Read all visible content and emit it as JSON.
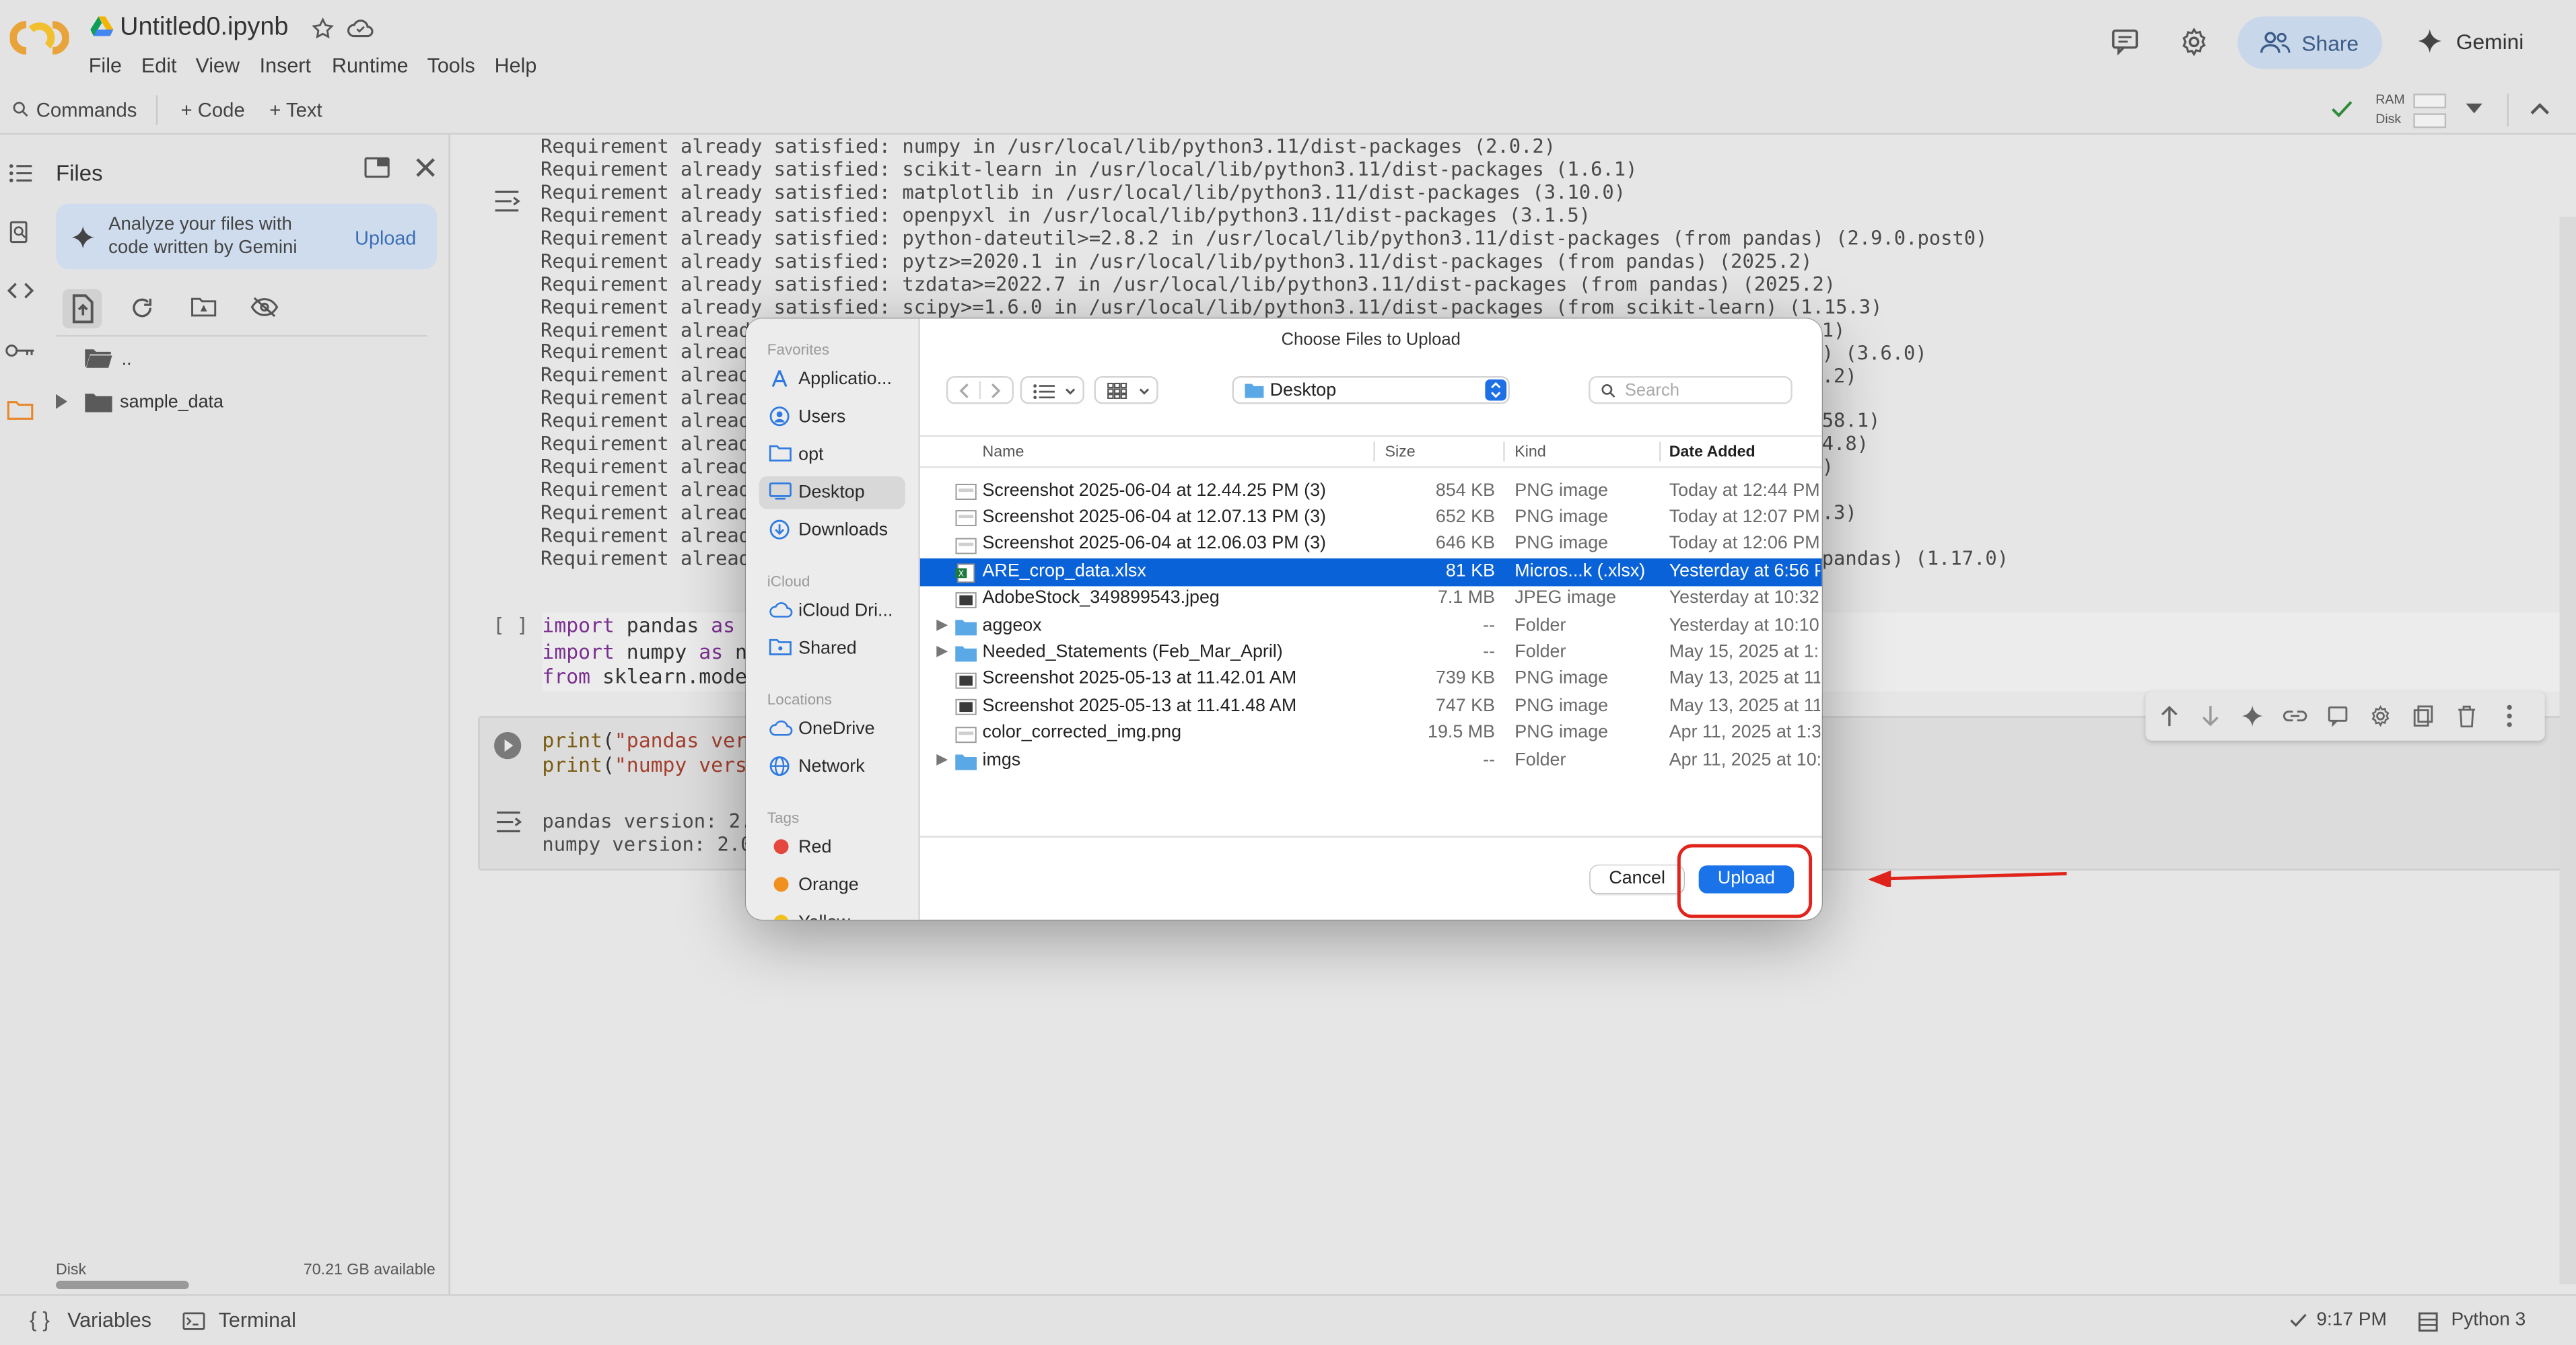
{
  "header": {
    "notebook_title": "Untitled0.ipynb",
    "menu": [
      "File",
      "Edit",
      "View",
      "Insert",
      "Runtime",
      "Tools",
      "Help"
    ],
    "share_label": "Share",
    "gemini_label": "Gemini"
  },
  "toolbar": {
    "commands_label": "Commands",
    "add_code_label": "+ Code",
    "add_text_label": "+ Text",
    "ram_label": "RAM",
    "disk_label": "Disk"
  },
  "sidebar": {
    "title": "Files",
    "gemini_prompt": "Analyze your files with code written by Gemini",
    "gemini_upload": "Upload",
    "tree": [
      {
        "label": ".."
      },
      {
        "label": "sample_data"
      }
    ],
    "disk_label": "Disk",
    "disk_available": "70.21 GB available"
  },
  "output_lines": [
    "Requirement already satisfied: numpy in /usr/local/lib/python3.11/dist-packages (2.0.2)",
    "Requirement already satisfied: scikit-learn in /usr/local/lib/python3.11/dist-packages (1.6.1)",
    "Requirement already satisfied: matplotlib in /usr/local/lib/python3.11/dist-packages (3.10.0)",
    "Requirement already satisfied: openpyxl in /usr/local/lib/python3.11/dist-packages (3.1.5)",
    "Requirement already satisfied: python-dateutil>=2.8.2 in /usr/local/lib/python3.11/dist-packages (from pandas) (2.9.0.post0)",
    "Requirement already satisfied: pytz>=2020.1 in /usr/local/lib/python3.11/dist-packages (from pandas) (2025.2)",
    "Requirement already satisfied: tzdata>=2022.7 in /usr/local/lib/python3.11/dist-packages (from pandas) (2025.2)",
    "Requirement already satisfied: scipy>=1.6.0 in /usr/local/lib/python3.11/dist-packages (from scikit-learn) (1.15.3)",
    "Requirement alread",
    "Requirement alread",
    "Requirement alread",
    "Requirement alread",
    "Requirement alread",
    "Requirement alread",
    "Requirement alread",
    "Requirement alread",
    "Requirement alread",
    "Requirement alread",
    "Requirement alread"
  ],
  "output_tails": [
    {
      "line": 8,
      "text": "1)"
    },
    {
      "line": 9,
      "text": ") (3.6.0)"
    },
    {
      "line": 10,
      "text": ".2)"
    },
    {
      "line": 12,
      "text": "58.1)"
    },
    {
      "line": 13,
      "text": "4.8)"
    },
    {
      "line": 14,
      "text": ")"
    },
    {
      "line": 16,
      "text": ".3)"
    },
    {
      "line": 18,
      "text": "pandas) (1.17.0)"
    }
  ],
  "cell2": {
    "prompt": "[ ]",
    "line1": {
      "kw1": "import",
      "rest": " pandas ",
      "kw2": "as",
      "tail": " p"
    },
    "line2": {
      "kw1": "import",
      "rest": " numpy ",
      "kw2": "as",
      "tail": " np"
    },
    "line3": {
      "kw1": "from",
      "rest": " sklearn.model"
    }
  },
  "cell3": {
    "line1": {
      "fn": "print",
      "open": "(",
      "str": "\"pandas vers"
    },
    "line2": {
      "fn": "print",
      "open": "(",
      "str": "\"numpy versi"
    },
    "out1": "pandas version: 2.",
    "out2": "numpy version: 2.0"
  },
  "statusbar": {
    "variables_label": "Variables",
    "terminal_label": "Terminal",
    "time": "9:17 PM",
    "runtime": "Python 3"
  },
  "dialog": {
    "title": "Choose Files to Upload",
    "location": "Desktop",
    "search_placeholder": "Search",
    "sections": {
      "favorites": "Favorites",
      "icloud": "iCloud",
      "locations": "Locations",
      "tags": "Tags"
    },
    "favorites": [
      "Applicatio...",
      "Users",
      "opt",
      "Desktop",
      "Downloads"
    ],
    "icloud": [
      "iCloud Dri...",
      "Shared"
    ],
    "locations": [
      "OneDrive",
      "Network"
    ],
    "tags": [
      {
        "label": "Red",
        "color": "#e5463d"
      },
      {
        "label": "Orange",
        "color": "#f0901e"
      },
      {
        "label": "Yellow",
        "color": "#f2c21b"
      }
    ],
    "columns": {
      "name": "Name",
      "size": "Size",
      "kind": "Kind",
      "date": "Date Added"
    },
    "files": [
      {
        "name": "Screenshot 2025-06-04 at 12.44.25 PM (3)",
        "size": "854 KB",
        "kind": "PNG image",
        "date": "Today at 12:44 PM",
        "icon": "image-file-icon",
        "folder": false,
        "selected": false
      },
      {
        "name": "Screenshot 2025-06-04 at 12.07.13 PM (3)",
        "size": "652 KB",
        "kind": "PNG image",
        "date": "Today at 12:07 PM",
        "icon": "image-file-icon",
        "folder": false,
        "selected": false
      },
      {
        "name": "Screenshot 2025-06-04 at 12.06.03 PM (3)",
        "size": "646 KB",
        "kind": "PNG image",
        "date": "Today at 12:06 PM",
        "icon": "image-file-icon",
        "folder": false,
        "selected": false
      },
      {
        "name": "ARE_crop_data.xlsx",
        "size": "81 KB",
        "kind": "Micros...k (.xlsx)",
        "date": "Yesterday at 6:56 P",
        "icon": "excel-file-icon",
        "folder": false,
        "selected": true
      },
      {
        "name": "AdobeStock_349899543.jpeg",
        "size": "7.1 MB",
        "kind": "JPEG image",
        "date": "Yesterday at 10:32",
        "icon": "photo-file-icon",
        "folder": false,
        "selected": false
      },
      {
        "name": "aggeox",
        "size": "--",
        "kind": "Folder",
        "date": "Yesterday at 10:10",
        "icon": "folder-icon",
        "folder": true,
        "selected": false
      },
      {
        "name": "Needed_Statements (Feb_Mar_April)",
        "size": "--",
        "kind": "Folder",
        "date": "May 15, 2025 at 1:",
        "icon": "folder-icon",
        "folder": true,
        "selected": false
      },
      {
        "name": "Screenshot 2025-05-13 at 11.42.01 AM",
        "size": "739 KB",
        "kind": "PNG image",
        "date": "May 13, 2025 at 11",
        "icon": "photo-file-icon",
        "folder": false,
        "selected": false
      },
      {
        "name": "Screenshot 2025-05-13 at 11.41.48 AM",
        "size": "747 KB",
        "kind": "PNG image",
        "date": "May 13, 2025 at 11",
        "icon": "photo-file-icon",
        "folder": false,
        "selected": false
      },
      {
        "name": "color_corrected_img.png",
        "size": "19.5 MB",
        "kind": "PNG image",
        "date": "Apr 11, 2025 at 1:3",
        "icon": "image-file-icon",
        "folder": false,
        "selected": false
      },
      {
        "name": "imgs",
        "size": "--",
        "kind": "Folder",
        "date": "Apr 11, 2025 at 10:",
        "icon": "folder-icon",
        "folder": true,
        "selected": false
      }
    ],
    "cancel_label": "Cancel",
    "upload_label": "Upload"
  },
  "colors": {
    "accent": "#0a62d8",
    "highlight": "#e0241b",
    "folder": "#5aa8e6"
  }
}
